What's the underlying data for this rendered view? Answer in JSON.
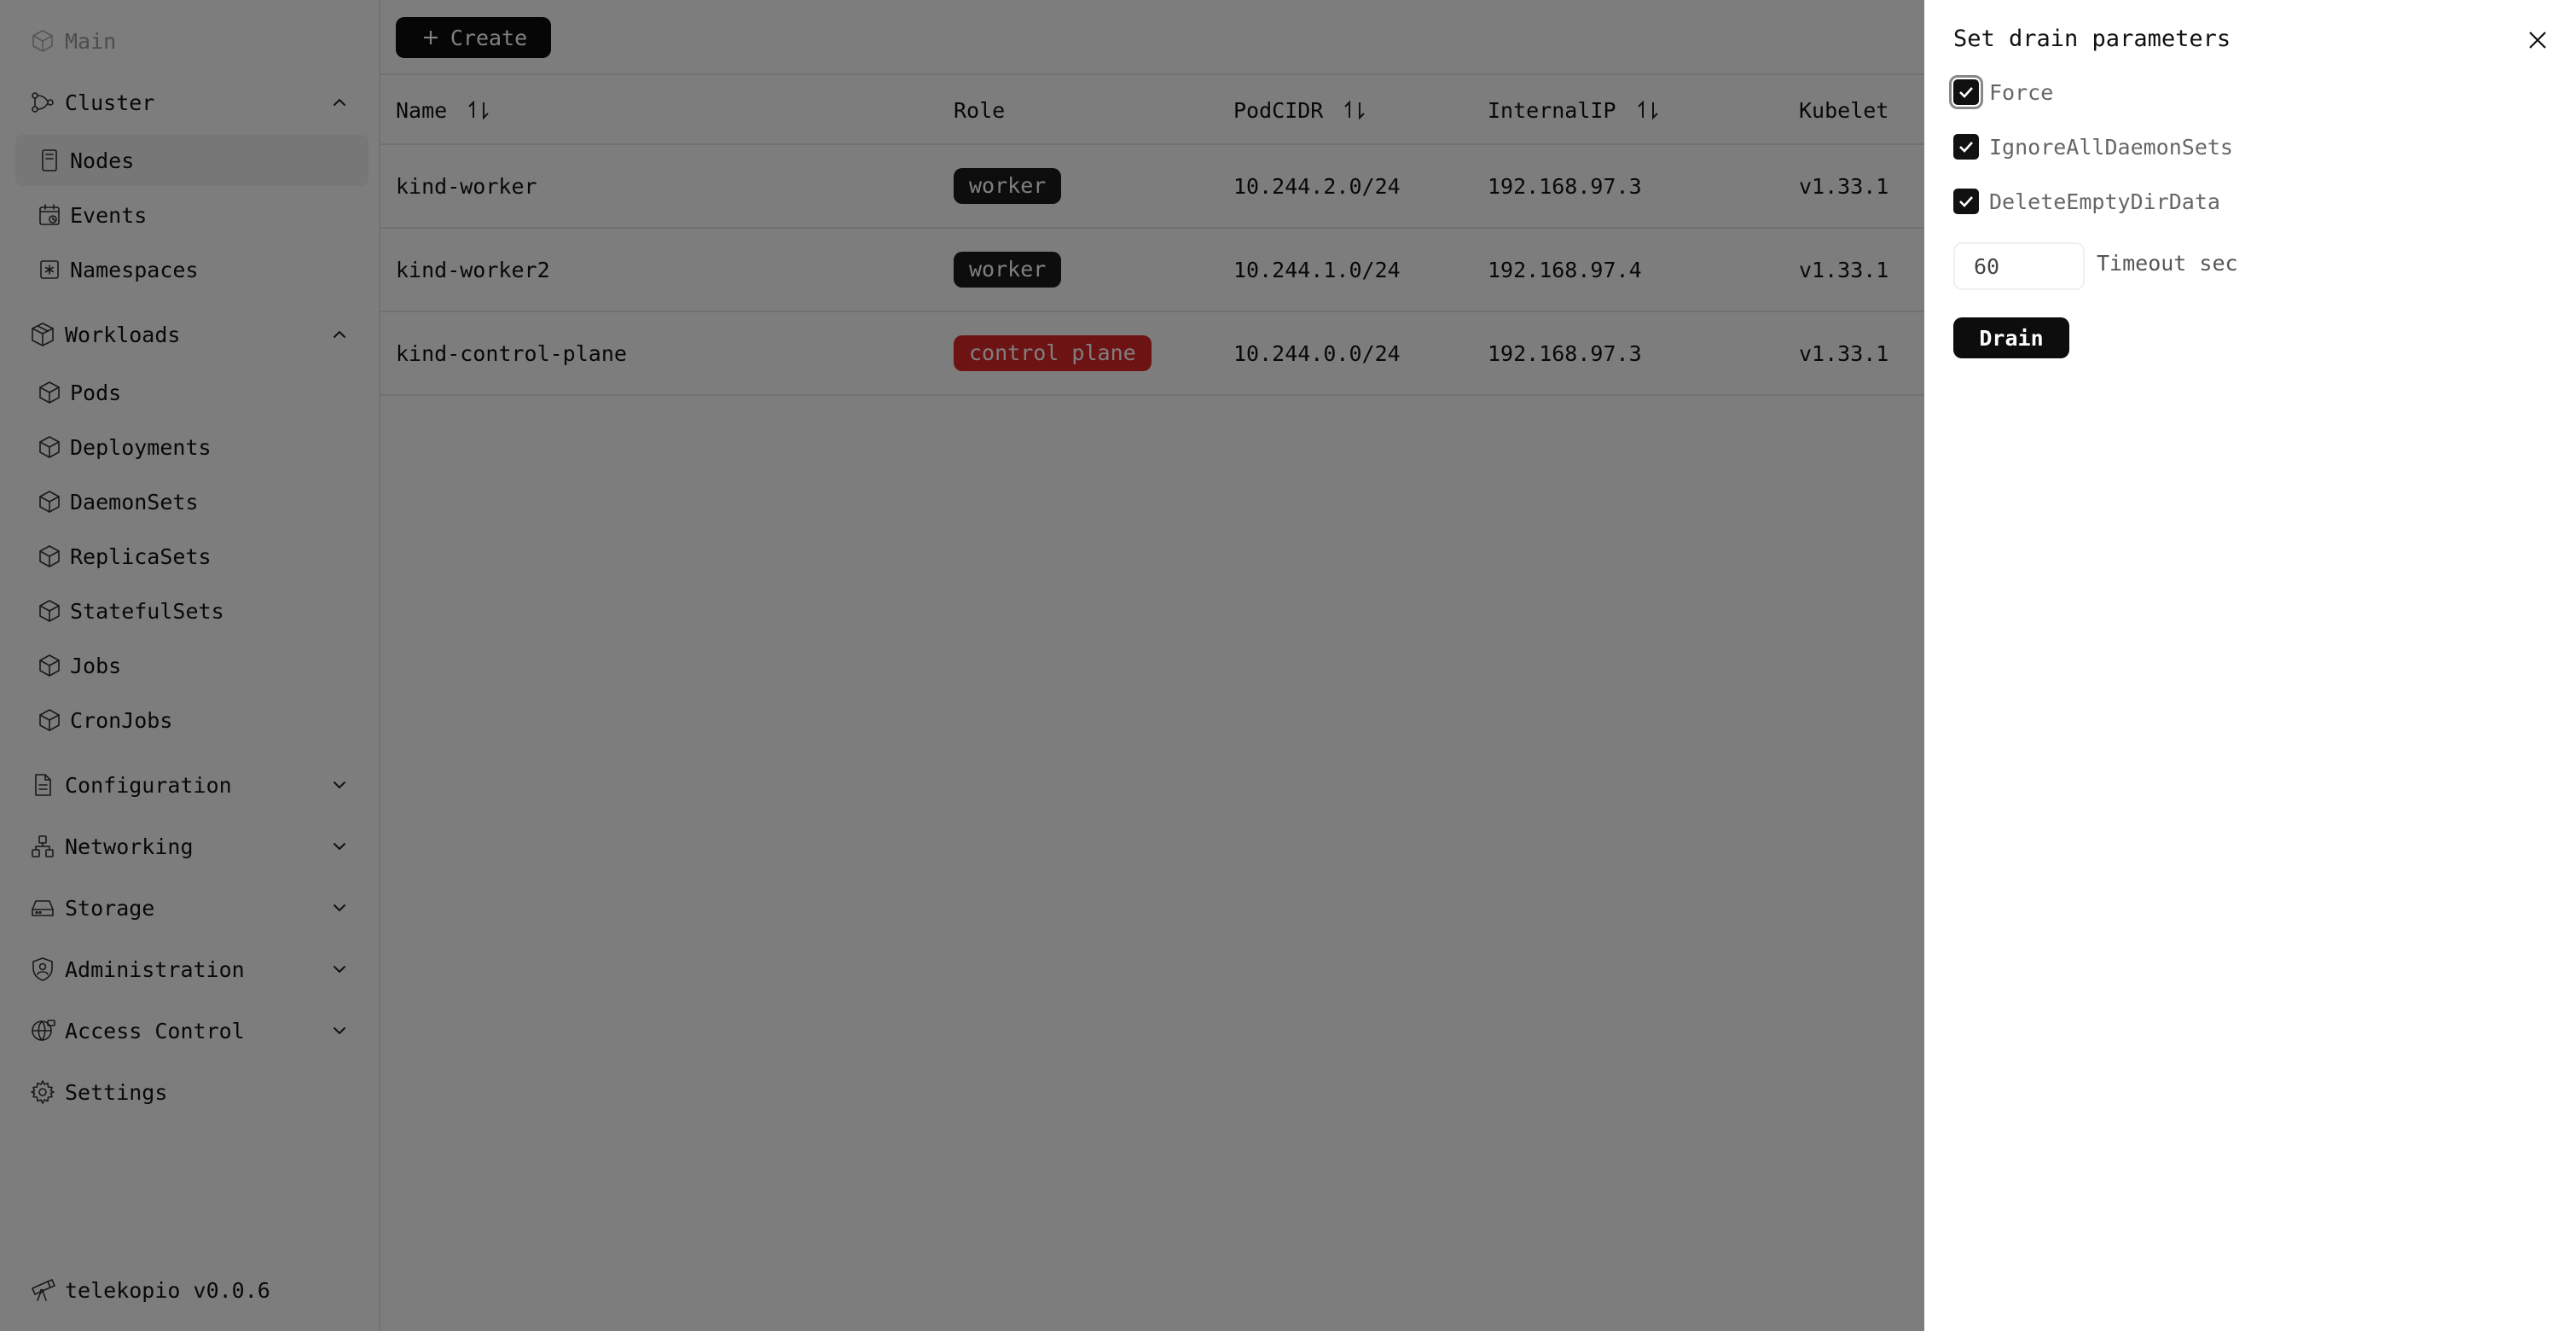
{
  "sidebar": {
    "main_label": "Main",
    "cluster": {
      "label": "Cluster",
      "items": [
        "Nodes",
        "Events",
        "Namespaces"
      ]
    },
    "workloads": {
      "label": "Workloads",
      "items": [
        "Pods",
        "Deployments",
        "DaemonSets",
        "ReplicaSets",
        "StatefulSets",
        "Jobs",
        "CronJobs"
      ]
    },
    "sections": [
      "Configuration",
      "Networking",
      "Storage",
      "Administration",
      "Access Control"
    ],
    "settings_label": "Settings",
    "footer": "telekopio v0.0.6"
  },
  "toolbar": {
    "create_label": "Create"
  },
  "table": {
    "headers": [
      "Name",
      "Role",
      "PodCIDR",
      "InternalIP",
      "Kubelet"
    ],
    "rows": [
      {
        "name": "kind-worker",
        "role": "worker",
        "podcidr": "10.244.2.0/24",
        "internal_ip": "192.168.97.3",
        "kubelet": "v1.33.1"
      },
      {
        "name": "kind-worker2",
        "role": "worker",
        "podcidr": "10.244.1.0/24",
        "internal_ip": "192.168.97.4",
        "kubelet": "v1.33.1"
      },
      {
        "name": "kind-control-plane",
        "role": "control plane",
        "podcidr": "10.244.0.0/24",
        "internal_ip": "192.168.97.3",
        "kubelet": "v1.33.1"
      }
    ]
  },
  "drawer": {
    "title": "Set drain parameters",
    "options": [
      {
        "label": "Force",
        "checked": true
      },
      {
        "label": "IgnoreAllDaemonSets",
        "checked": true
      },
      {
        "label": "DeleteEmptyDirData",
        "checked": true
      }
    ],
    "timeout_value": "60",
    "timeout_label": "Timeout sec",
    "drain_label": "Drain"
  },
  "colors": {
    "worker_badge": "#1a1a1a",
    "control_plane_badge": "#dc2626",
    "overlay": "rgba(0,0,0,0.5)"
  }
}
